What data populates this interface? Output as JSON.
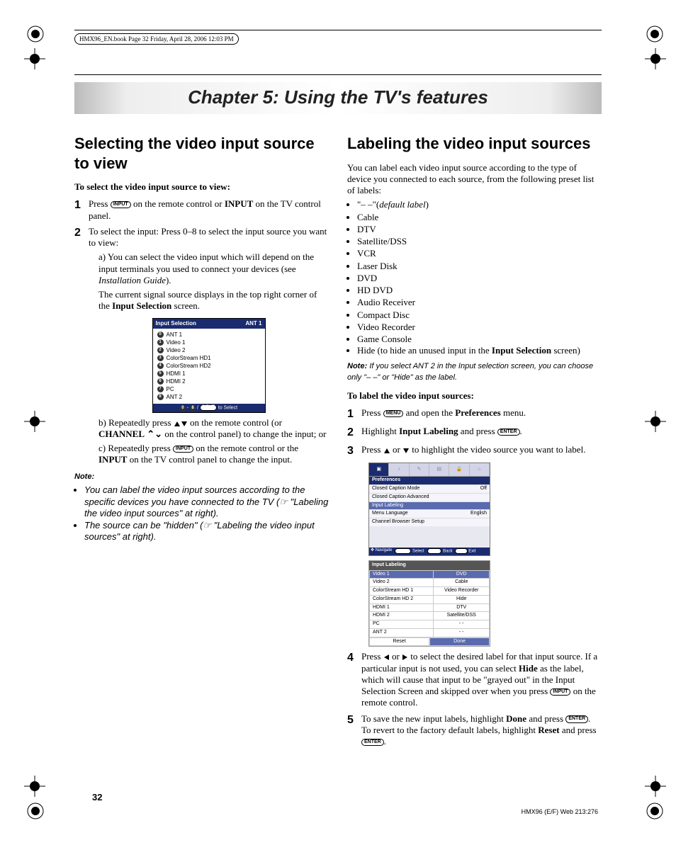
{
  "header_text": "HMX96_EN.book  Page 32  Friday, April 28, 2006  12:03 PM",
  "chapter_title": "Chapter 5: Using the TV's features",
  "left": {
    "h2": "Selecting the video input source to view",
    "sub1": "To select the video input source to view:",
    "step1": {
      "num": "1",
      "a": "Press ",
      "btn": "INPUT",
      "b": " on the remote control or ",
      "c": "INPUT",
      "d": " on the TV control panel."
    },
    "step2": {
      "num": "2",
      "intro": "To select the input: Press 0–8 to select the input source you want to view:"
    },
    "step2a": "a) You can select the video input which will depend on the input terminals you used to connect your devices (see ",
    "step2a_em": "Installation Guide",
    "step2a_end": ").",
    "step2_current": "The current signal source displays in the top right corner of the ",
    "step2_current_bold": "Input Selection",
    "step2_current_end": " screen.",
    "screen": {
      "title": "Input Selection",
      "right": "ANT 1",
      "rows": [
        {
          "n": "0",
          "t": "ANT 1"
        },
        {
          "n": "1",
          "t": "Video 1"
        },
        {
          "n": "2",
          "t": "Video 2"
        },
        {
          "n": "3",
          "t": "ColorStream HD1"
        },
        {
          "n": "4",
          "t": "ColorStream HD2"
        },
        {
          "n": "5",
          "t": "HDMI 1"
        },
        {
          "n": "6",
          "t": "HDMI 2"
        },
        {
          "n": "7",
          "t": "PC"
        },
        {
          "n": "8",
          "t": "ANT 2"
        }
      ],
      "footer_a": " - ",
      "footer_b": " / ",
      "footer_btn": "INPUT",
      "footer_c": " to Select"
    },
    "step2b_a": "b) Repeatedly press ",
    "step2b_b": " on the remote control (or ",
    "step2b_bold": "CHANNEL",
    "step2b_c": " on the control panel) to change the input; or",
    "step2c_a": "c) Repeatedly press ",
    "step2c_btn": "INPUT",
    "step2c_b": " on the remote control or the ",
    "step2c_bold": "INPUT",
    "step2c_c": " on the TV control panel to change the input.",
    "note_label": "Note:",
    "note1": "You can label the video input sources according to the specific devices you have connected to the TV (☞ \"Labeling the video input sources\" at right).",
    "note2": "The source can be \"hidden\" (☞ \"Labeling the video input sources\" at right)."
  },
  "right": {
    "h2": "Labeling the video input sources",
    "intro": "You can label each video input source according to the type of device you connected to each source, from the following preset list of labels:",
    "bullets": [
      "\"– –\"(default label)",
      "Cable",
      "DTV",
      "Satellite/DSS",
      "VCR",
      "Laser Disk",
      "DVD",
      "HD DVD",
      "Audio Receiver",
      "Compact Disc",
      "Video Recorder",
      "Game Console"
    ],
    "bullet_hide_a": "Hide (to hide an unused input in the ",
    "bullet_hide_bold": "Input Selection",
    "bullet_hide_b": " screen)",
    "note_label": "Note:",
    "note_text": "If you select ANT 2 in the Input selection screen, you can choose only \"– –\" or \"Hide\" as the label.",
    "sub2": "To label the video input sources:",
    "step1": {
      "num": "1",
      "a": "Press ",
      "btn": "MENU",
      "b": " and open the ",
      "bold": "Preferences",
      "c": " menu."
    },
    "step2": {
      "num": "2",
      "a": "Highlight ",
      "bold": "Input Labeling",
      "b": " and press ",
      "btn": "ENTER",
      "c": "."
    },
    "step3": {
      "num": "3",
      "a": "Press ",
      "b": " or ",
      "c": " to highlight the video source you want to label."
    },
    "pref_screen": {
      "title": "Preferences",
      "rows": [
        {
          "l": "Closed Caption Mode",
          "r": "Off"
        },
        {
          "l": "Closed Caption Advanced",
          "r": ""
        }
      ],
      "hl": "Input Labeling",
      "rows2": [
        {
          "l": "Menu Language",
          "r": "English"
        },
        {
          "l": "Channel Browser Setup",
          "r": ""
        }
      ],
      "nav_navigate": "Navigate",
      "nav_select": "Select",
      "nav_back": "Back",
      "nav_exit": "Exit",
      "nav_b1": "ENTER",
      "nav_b2": "MENU",
      "nav_b3": "EXIT"
    },
    "label_screen": {
      "title": "Input Labeling",
      "rows": [
        {
          "l": "Video 1",
          "r": "DVD"
        },
        {
          "l": "Video 2",
          "r": "Cable"
        },
        {
          "l": "ColorStream HD 1",
          "r": "Video Recorder"
        },
        {
          "l": "ColorStream HD 2",
          "r": "Hide"
        },
        {
          "l": "HDMI 1",
          "r": "DTV"
        },
        {
          "l": "HDMI 2",
          "r": "Satellite/DSS"
        },
        {
          "l": "PC",
          "r": "- -"
        },
        {
          "l": "ANT 2",
          "r": "- -"
        }
      ],
      "reset": "Reset",
      "done": "Done"
    },
    "step4": {
      "num": "4",
      "a": "Press ",
      "b": " or ",
      "c": " to select the desired label for that input source. If a particular input is not used, you can select ",
      "bold": "Hide",
      "d": " as the label, which will cause that input to be \"grayed out\" in the Input Selection Screen and skipped over when you press ",
      "btn": "INPUT",
      "e": " on the remote control."
    },
    "step5": {
      "num": "5",
      "a": "To save the new input labels, highlight ",
      "bold1": "Done",
      "b": " and press ",
      "btn1": "ENTER",
      "c": ".",
      "line2a": "To revert to the factory default labels, highlight ",
      "bold2": "Reset",
      "line2b": " and press ",
      "btn2": "ENTER",
      "line2c": "."
    }
  },
  "page_number": "32",
  "footer": "HMX96 (E/F) Web 213:276"
}
